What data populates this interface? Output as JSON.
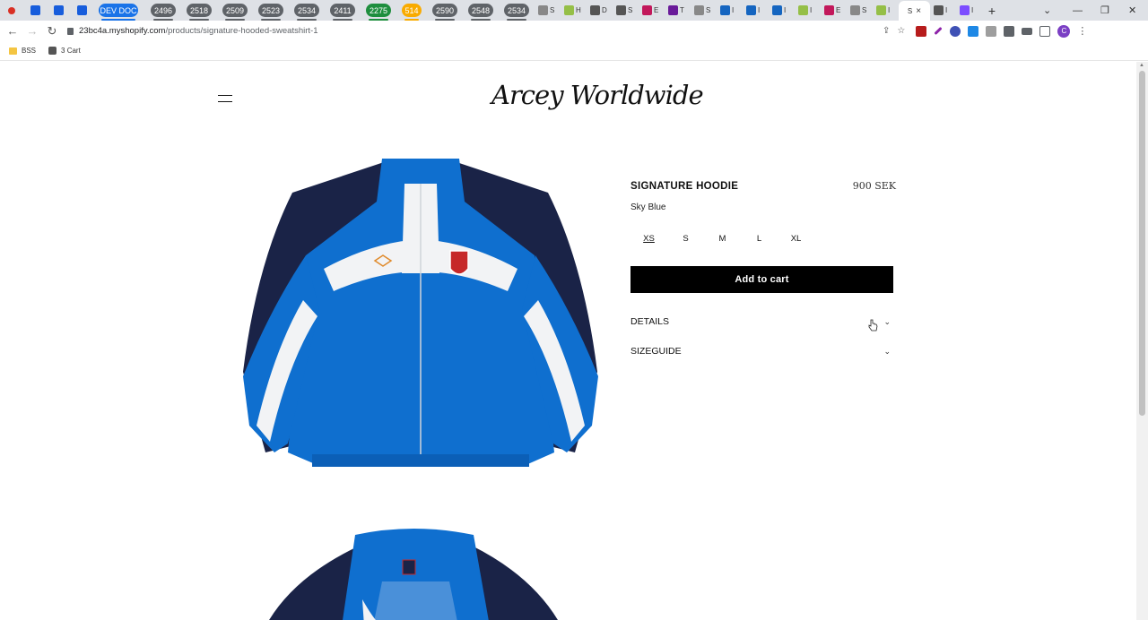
{
  "browser": {
    "tabs": {
      "pills": [
        {
          "label": "DEV DOC",
          "color": "#1a73e8",
          "underline": "#1a73e8"
        },
        {
          "label": "2496",
          "color": "#5f6368",
          "underline": "#5f6368"
        },
        {
          "label": "2518",
          "color": "#5f6368",
          "underline": "#5f6368"
        },
        {
          "label": "2509",
          "color": "#5f6368",
          "underline": "#5f6368"
        },
        {
          "label": "2523",
          "color": "#5f6368",
          "underline": "#5f6368"
        },
        {
          "label": "2534",
          "color": "#5f6368",
          "underline": "#5f6368"
        },
        {
          "label": "2411",
          "color": "#5f6368",
          "underline": "#5f6368"
        },
        {
          "label": "2275",
          "color": "#1e8e3e",
          "underline": "#1e8e3e"
        },
        {
          "label": "514",
          "color": "#f9ab00",
          "underline": "#f9ab00"
        },
        {
          "label": "2590",
          "color": "#5f6368",
          "underline": "#5f6368"
        },
        {
          "label": "2548",
          "color": "#5f6368",
          "underline": "#5f6368"
        },
        {
          "label": "2534",
          "color": "#5f6368",
          "underline": "#5f6368"
        }
      ],
      "small_tabs": [
        {
          "letter": "S",
          "color": "#888888"
        },
        {
          "letter": "H",
          "color": "#95bf47"
        },
        {
          "letter": "D",
          "color": "#555555"
        },
        {
          "letter": "S",
          "color": "#555555"
        },
        {
          "letter": "E",
          "color": "#c2185b"
        },
        {
          "letter": "T",
          "color": "#6a1b9a"
        },
        {
          "letter": "S",
          "color": "#888888"
        },
        {
          "letter": "I",
          "color": "#1565c0"
        },
        {
          "letter": "I",
          "color": "#1565c0"
        },
        {
          "letter": "I",
          "color": "#1565c0"
        },
        {
          "letter": "I",
          "color": "#95bf47"
        },
        {
          "letter": "E",
          "color": "#c2185b"
        },
        {
          "letter": "S",
          "color": "#888888"
        },
        {
          "letter": "I",
          "color": "#95bf47"
        }
      ],
      "active_tab_letter": "S",
      "after_tabs": [
        {
          "letter": "I",
          "color": "#555555"
        },
        {
          "letter": "I",
          "color": "#7c4dff"
        }
      ],
      "close_glyph": "×",
      "new_tab_glyph": "+"
    },
    "window_controls": {
      "dropdown": "⌄",
      "minimize": "—",
      "restore": "❐",
      "close": "✕"
    },
    "address_bar": {
      "host": "23bc4a.myshopify.com",
      "path": "/products/signature-hooded-sweatshirt-1",
      "profile_initial": "C"
    },
    "bookmarks": [
      {
        "label": "BSS",
        "icon": "folder-icon"
      },
      {
        "label": "3 Cart",
        "icon": "cat-icon"
      }
    ]
  },
  "store": {
    "logo": "Arcey Worldwide"
  },
  "product": {
    "title": "SIGNATURE HOODIE",
    "price": "900 SEK",
    "color": "Sky Blue",
    "sizes": [
      "XS",
      "S",
      "M",
      "L",
      "XL"
    ],
    "selected_size": "XS",
    "add_to_cart": "Add to cart",
    "accordions": [
      "DETAILS",
      "SIZEGUIDE"
    ]
  },
  "colors": {
    "jacket_blue": "#0f6fcf",
    "jacket_navy": "#1a2347",
    "jacket_white": "#f2f3f5",
    "cart_button": "#000000"
  }
}
